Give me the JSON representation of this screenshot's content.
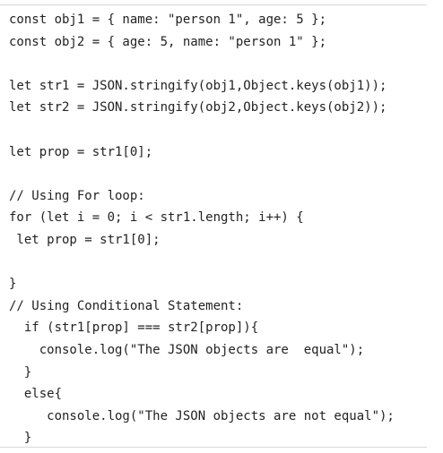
{
  "code_block": {
    "lines": [
      "const obj1 = { name: \"person 1\", age: 5 };",
      "const obj2 = { age: 5, name: \"person 1\" };",
      "",
      "let str1 = JSON.stringify(obj1,Object.keys(obj1));",
      "let str2 = JSON.stringify(obj2,Object.keys(obj2));",
      "",
      "let prop = str1[0];",
      "",
      "// Using For loop:",
      "for (let i = 0; i < str1.length; i++) {",
      " let prop = str1[0];",
      "",
      "}",
      "// Using Conditional Statement:",
      "  if (str1[prop] === str2[prop]){",
      "    console.log(\"The JSON objects are  equal\");",
      "  }",
      "  else{",
      "     console.log(\"The JSON objects are not equal\");",
      "  }"
    ]
  }
}
